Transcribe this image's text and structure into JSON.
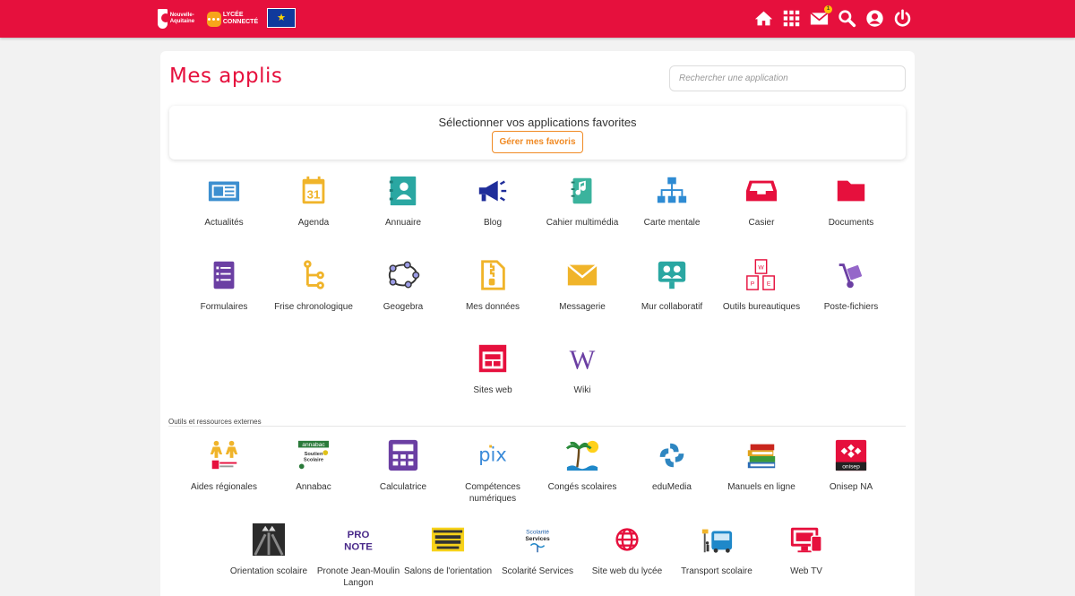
{
  "header": {
    "logo_region_text": "Nouvelle-Aquitaine",
    "logo_lycee_text": "LYCÉE CONNECTÉ",
    "icons": [
      "home-icon",
      "apps-grid-icon",
      "messages-icon",
      "search-icon",
      "profile-icon",
      "power-icon"
    ],
    "messages_badge": "1"
  },
  "page": {
    "title": "Mes applis",
    "search_placeholder": "Rechercher une application"
  },
  "favorites": {
    "prompt": "Sélectionner vos applications favorites",
    "button": "Gérer mes favoris"
  },
  "apps": [
    {
      "label": "Actualités",
      "icon": "newspaper-icon",
      "color": "#3d8fd0"
    },
    {
      "label": "Agenda",
      "icon": "calendar-icon",
      "color": "#f0b42a"
    },
    {
      "label": "Annuaire",
      "icon": "address-book-icon",
      "color": "#2aa7a2"
    },
    {
      "label": "Blog",
      "icon": "megaphone-icon",
      "color": "#1f2d9a"
    },
    {
      "label": "Cahier multimédia",
      "icon": "multimedia-notebook-icon",
      "color": "#3bb39d"
    },
    {
      "label": "Carte mentale",
      "icon": "mindmap-icon",
      "color": "#2e8bd3"
    },
    {
      "label": "Casier",
      "icon": "inbox-tray-icon",
      "color": "#e6103d"
    },
    {
      "label": "Documents",
      "icon": "folder-icon",
      "color": "#e6103d"
    },
    {
      "label": "Formulaires",
      "icon": "form-icon",
      "color": "#6b3fa3"
    },
    {
      "label": "Frise chronologique",
      "icon": "timeline-icon",
      "color": "#f0b42a"
    },
    {
      "label": "Geogebra",
      "icon": "geogebra-icon",
      "color": "#3d3ec9"
    },
    {
      "label": "Mes données",
      "icon": "zip-file-icon",
      "color": "#f0b42a"
    },
    {
      "label": "Messagerie",
      "icon": "envelope-icon",
      "color": "#f0b42a"
    },
    {
      "label": "Mur collaboratif",
      "icon": "collaborative-wall-icon",
      "color": "#2aa7a2"
    },
    {
      "label": "Outils bureautiques",
      "icon": "office-tools-icon",
      "color": "#e6103d"
    },
    {
      "label": "Poste-fichiers",
      "icon": "hand-truck-icon",
      "color": "#6b3fa3"
    },
    {
      "label": "Sites web",
      "icon": "website-icon",
      "color": "#e6103d"
    },
    {
      "label": "Wiki",
      "icon": "wiki-icon",
      "color": "#6b3fa3"
    }
  ],
  "external": {
    "section_title": "Outils et ressources externes",
    "items": [
      {
        "label": "Aides régionales",
        "icon": "regional-aid-icon"
      },
      {
        "label": "Annabac",
        "icon": "annabac-logo-icon",
        "logo_text": "annabac Soutien Scolaire"
      },
      {
        "label": "Calculatrice",
        "icon": "calculator-icon"
      },
      {
        "label": "Compétences numériques",
        "icon": "pix-logo-icon",
        "logo_text": "pix"
      },
      {
        "label": "Congés scolaires",
        "icon": "beach-icon"
      },
      {
        "label": "eduMedia",
        "icon": "edumedia-logo-icon"
      },
      {
        "label": "Manuels en ligne",
        "icon": "books-icon"
      },
      {
        "label": "Onisep NA",
        "icon": "onisep-logo-icon",
        "logo_text": "onisep"
      },
      {
        "label": "Orientation scolaire",
        "icon": "crossroads-icon"
      },
      {
        "label": "Pronote Jean-Moulin Langon",
        "icon": "pronote-logo-icon",
        "logo_text": "PRO NOTE"
      },
      {
        "label": "Salons de l'orientation",
        "icon": "orientation-fair-icon"
      },
      {
        "label": "Scolarité Services",
        "icon": "scolarite-services-logo-icon",
        "logo_text": "Scolarité Services"
      },
      {
        "label": "Site web du lycée",
        "icon": "globe-icon"
      },
      {
        "label": "Transport scolaire",
        "icon": "bus-stop-icon"
      },
      {
        "label": "Web TV",
        "icon": "web-tv-icon"
      }
    ]
  }
}
